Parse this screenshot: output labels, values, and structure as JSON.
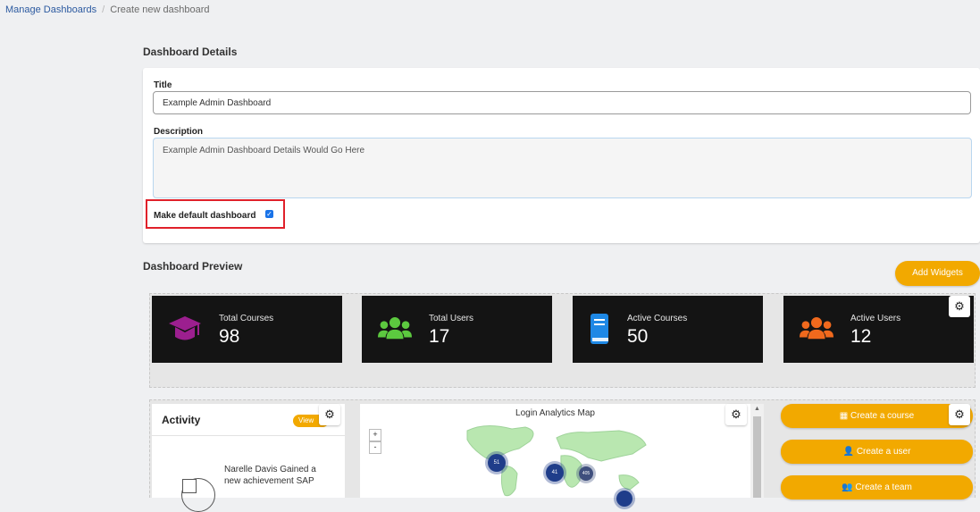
{
  "breadcrumb": {
    "parent": "Manage Dashboards",
    "separator": "/",
    "current": "Create new dashboard"
  },
  "details": {
    "heading": "Dashboard Details",
    "title_label": "Title",
    "title_value": "Example Admin Dashboard",
    "description_label": "Description",
    "description_value": "Example Admin Dashboard Details Would Go Here",
    "default_label": "Make default dashboard",
    "default_checked": true
  },
  "preview": {
    "heading": "Dashboard Preview",
    "add_widgets_label": "Add Widgets",
    "stats": [
      {
        "label": "Total Courses",
        "value": "98",
        "icon": "graduation-cap-icon",
        "color": "#9c1f8f"
      },
      {
        "label": "Total Users",
        "value": "17",
        "icon": "users-icon",
        "color": "#5cc93f"
      },
      {
        "label": "Active Courses",
        "value": "50",
        "icon": "book-icon",
        "color": "#1e88e5"
      },
      {
        "label": "Active Users",
        "value": "12",
        "icon": "users-icon",
        "color": "#f0691d"
      }
    ],
    "activity": {
      "title": "Activity",
      "view_label": "View",
      "item_text": "Narelle Davis Gained a new achievement SAP"
    },
    "map": {
      "title": "Login Analytics Map",
      "zoom_in": "+",
      "zoom_out": "-",
      "clusters": [
        "51",
        "41",
        "405"
      ]
    },
    "actions": [
      "Create a course",
      "Create a user",
      "Create a team"
    ]
  },
  "colors": {
    "accent": "#f2a900",
    "link": "#2c5aa0",
    "highlight": "#e0202a",
    "tile_bg": "#141414"
  }
}
